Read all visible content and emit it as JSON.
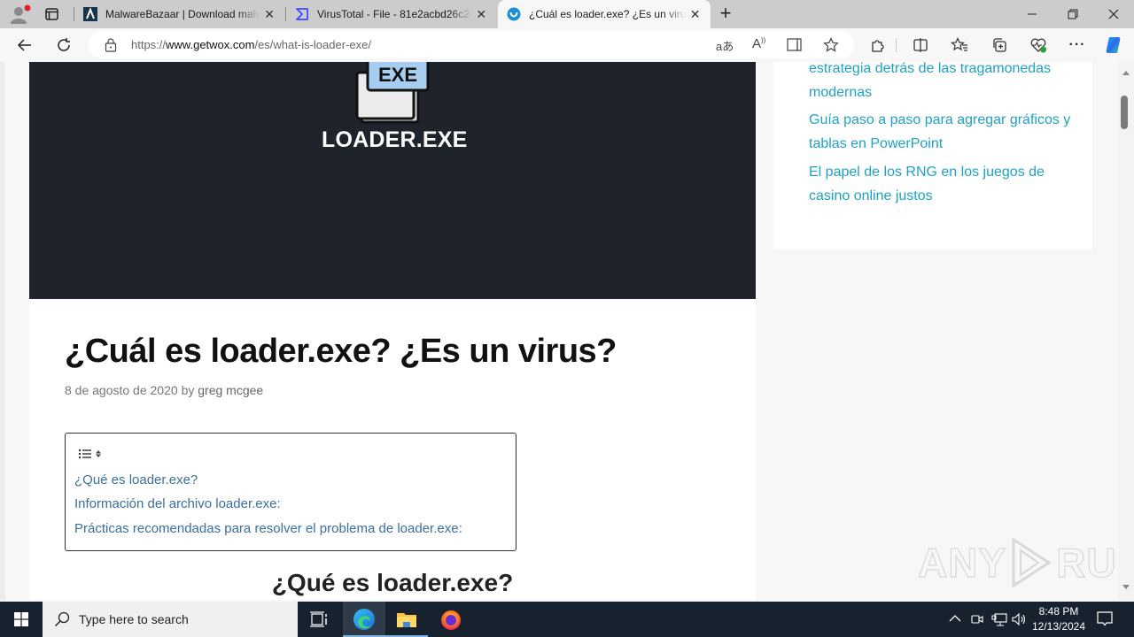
{
  "browser": {
    "tabs": [
      {
        "title": "MalwareBazaar | Download malw",
        "icon": "malwarebazaar-icon",
        "active": false
      },
      {
        "title": "VirusTotal - File - 81e2acbd26c2d",
        "icon": "virustotal-icon",
        "active": false
      },
      {
        "title": "¿Cuál es loader.exe? ¿Es un virus?",
        "icon": "getwox-icon",
        "active": true
      }
    ],
    "new_tab_label": "+",
    "close_glyph": "✕",
    "url": {
      "scheme": "https://",
      "host": "www.getwox.com",
      "path": "/es/what-is-loader-exe/"
    }
  },
  "hero": {
    "badge_text": "EXE",
    "caption": "LOADER.EXE"
  },
  "article": {
    "title": "¿Cuál es loader.exe? ¿Es un virus?",
    "date": "8 de agosto de 2020",
    "by": "by",
    "author": "greg mcgee",
    "toc": {
      "items": [
        "¿Qué es loader.exe?",
        "Información del archivo loader.exe:",
        "Prácticas recomendadas para resolver el problema de loader.exe:"
      ]
    },
    "section_heading": "¿Qué es loader.exe?"
  },
  "sidebar": {
    "links": [
      "estrategia detrás de las tragamonedas modernas",
      "Guía paso a paso para agregar gráficos y tablas en PowerPoint",
      "El papel de los RNG en los juegos de casino online justos"
    ]
  },
  "watermark": {
    "left": "ANY",
    "right": "RUN"
  },
  "taskbar": {
    "search_placeholder": "Type here to search",
    "time": "8:48 PM",
    "date": "12/13/2024"
  },
  "colors": {
    "link": "#1fa2c4",
    "toc_link": "#3a6fa0",
    "hero_bg": "#1f232b",
    "taskbar_bg": "#18222e"
  }
}
